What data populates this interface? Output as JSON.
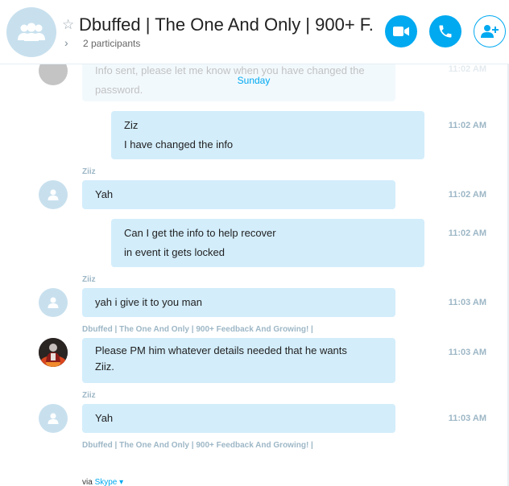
{
  "header": {
    "title": "Dbuffed | The One And Only | 900+ F...",
    "participants": "2 participants"
  },
  "chat": {
    "day_label": "Sunday",
    "cut_message": {
      "line1": "Info sent, please let me know when you have changed the",
      "line2": "password.",
      "time": "11:02 AM"
    },
    "messages": [
      {
        "lines": [
          "Ziz",
          "I have changed the info"
        ],
        "time": "11:02 AM"
      },
      {
        "sender": "Ziiz",
        "lines": [
          "Yah"
        ],
        "time": "11:02 AM"
      },
      {
        "lines": [
          "Can I get the info to help recover",
          "in event it gets locked"
        ],
        "time": "11:02 AM"
      },
      {
        "sender": "Ziiz",
        "lines": [
          "yah i give it to you man"
        ],
        "time": "11:03 AM"
      },
      {
        "sender": "Dbuffed | The One And Only | 900+ Feedback And Growing! |",
        "lines": [
          "Please PM him whatever details needed that he wants",
          "Ziiz."
        ],
        "time": "11:03 AM"
      },
      {
        "sender": "Ziiz",
        "lines": [
          "Yah"
        ],
        "time": "11:03 AM"
      }
    ],
    "cut_sender": "Dbuffed | The One And Only | 900+ Feedback And Growing! |"
  },
  "footer": {
    "via": "via",
    "service": "Skype"
  },
  "icons": {
    "group_avatar": "group-icon",
    "favorite": "star-outline-icon",
    "expand": "chevron-right-icon",
    "video": "video-camera-icon",
    "call": "phone-icon",
    "add_people": "add-person-icon",
    "dropdown": "caret-down-icon"
  },
  "colors": {
    "accent": "#00a9f0",
    "bubble": "#d3edfb",
    "avatar_bg": "#c8e0ee",
    "meta_text": "#9db7c6"
  }
}
